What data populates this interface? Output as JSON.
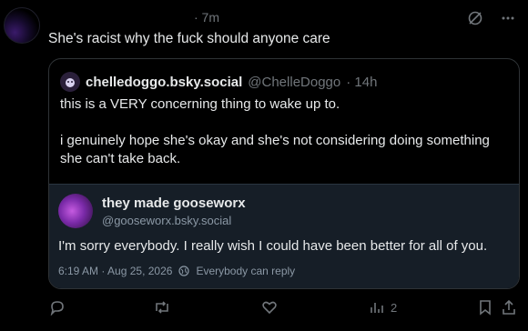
{
  "post": {
    "time": "· 7m",
    "text": "She's racist why the fuck should anyone care"
  },
  "quote": {
    "display_name": "chelledoggo.bsky.social",
    "handle": "@ChelleDoggo",
    "time": "· 14h",
    "line1": "this is a VERY concerning thing to wake up to.",
    "line2": "i genuinely hope she's okay and she's not considering doing something",
    "line3": "she can't take back."
  },
  "inner": {
    "display_name": "they made gooseworx",
    "handle": "@gooseworx.bsky.social",
    "text": "I'm sorry everybody. I really wish I could have been better for all of you.",
    "timestamp": "6:19 AM · Aug 25, 2026",
    "reply_setting": "Everybody can reply"
  },
  "actions": {
    "views_count": "2"
  },
  "icons": {
    "grok": "grok-icon",
    "more": "more-icon",
    "reply": "reply-icon",
    "repost": "repost-icon",
    "like": "like-icon",
    "views": "views-icon",
    "bookmark": "bookmark-icon",
    "share": "share-icon",
    "globe": "globe-icon"
  }
}
